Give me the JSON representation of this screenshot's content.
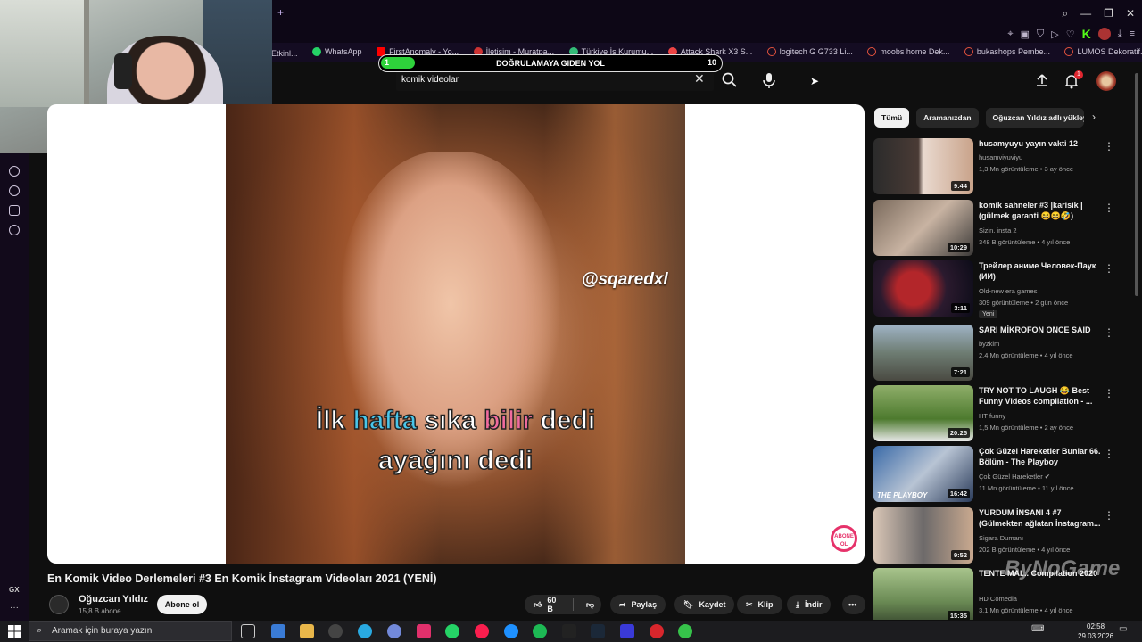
{
  "bookmarks": [
    "Etkinl...",
    "WhatsApp",
    "FirstAnomaly - Yo...",
    "İletişim - Muratpa...",
    "Türkiye İş Kurumu...",
    "Attack Shark X3 S...",
    "logitech G G733 Li...",
    "moobs home Dek...",
    "bukashops Pembe...",
    "LUMOS Dekoratif..."
  ],
  "verify_bar": {
    "label": "DOĞRULAMAYA GIDEN YOL",
    "left_num": "1",
    "right_num": "10",
    "progress": 0.1
  },
  "search": {
    "value": "komik videolar",
    "icon": "search-icon",
    "mic": "mic-icon"
  },
  "notifications": {
    "count": "1"
  },
  "video": {
    "handle": "@sqaredxl",
    "caption_line1": [
      "İlk ",
      "hafta",
      " sıka ",
      "bilir",
      " dedi"
    ],
    "caption_line2": "ayağını dedi",
    "subscribe_badge": "ABONE OL",
    "title": "En Komik Video Derlemeleri #3 En Komik İnstagram Videoları 2021 (YENİ)",
    "channel": "Oğuzcan Yıldız",
    "subscribers": "15,8 B abone",
    "subscribe_label": "Abone ol",
    "likes": "60 B",
    "share": "Paylaş",
    "save": "Kaydet",
    "clip": "Klip",
    "download": "İndir"
  },
  "chips": [
    "Tümü",
    "Aramanızdan",
    "Oğuzcan Yıldız adlı yükleyiciden"
  ],
  "recommendations": [
    {
      "title": "husamyuyu yayın vakti 12",
      "channel": "husamviyuviyu",
      "meta": "1,3 Mn görüntüleme • 3 ay önce",
      "duration": "9:44",
      "badge": ""
    },
    {
      "title": "komik sahneler #3 |karisik | (gülmek garanti 😆😆🤣)",
      "channel": "Sizin. insta 2",
      "meta": "348 B görüntüleme • 4 yıl önce",
      "duration": "10:29",
      "badge": ""
    },
    {
      "title": "Трейлер аниме Человек-Паук (ИИ)",
      "channel": "Old-new era games",
      "meta": "309 görüntüleme • 2 gün önce",
      "duration": "3:11",
      "badge": "Yeni"
    },
    {
      "title": "SARI MİKROFON ONCE SAID",
      "channel": "byzkim",
      "meta": "2,4 Mn görüntüleme • 4 yıl önce",
      "duration": "7:21",
      "badge": ""
    },
    {
      "title": "TRY NOT TO LAUGH 😂 Best Funny Videos compilation - ...",
      "channel": "HT funny",
      "meta": "1,5 Mn görüntüleme • 2 ay önce",
      "duration": "20:25",
      "badge": ""
    },
    {
      "title": "Çok Güzel Hareketler Bunlar 66. Bölüm - The Playboy",
      "channel": "Çok Güzel Hareketler ✔",
      "meta": "11 Mn görüntüleme • 11 yıl önce",
      "duration": "16:42",
      "badge": ""
    },
    {
      "title": "YURDUM İNSANI 4 #7 (Gülmekten ağlatan İnstagram...",
      "channel": "Sigara Dumanı",
      "meta": "202 B görüntüleme • 4 yıl önce",
      "duration": "9:52",
      "badge": ""
    },
    {
      "title": "TENTE MAI... Compilation 2020",
      "channel": "HD Comedia",
      "meta": "3,1 Mn görüntüleme • 4 yıl önce",
      "duration": "15:35",
      "badge": ""
    }
  ],
  "thumb_texts": {
    "playboy": "THE PLAYBOY"
  },
  "watermark": "ByNoGame",
  "taskbar": {
    "search_placeholder": "Aramak için buraya yazın",
    "time": "02:58",
    "date": "29.03.2026"
  },
  "gx_label": "GX"
}
